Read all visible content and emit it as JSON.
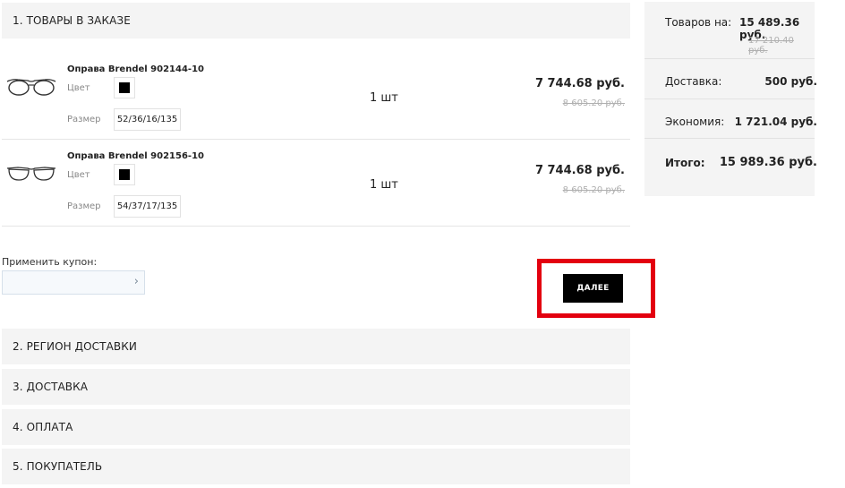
{
  "sections": {
    "cart": "1. ТОВАРЫ В ЗАКАЗЕ",
    "region": "2. РЕГИОН ДОСТАВКИ",
    "delivery": "3. ДОСТАВКА",
    "payment": "4. ОПЛАТА",
    "buyer": "5. ПОКУПАТЕЛЬ"
  },
  "items": [
    {
      "title": "Оправа Brendel 902144-10",
      "color_label": "Цвет",
      "color": "#000000",
      "size_label": "Размер",
      "size": "52/36/16/135",
      "qty": "1 шт",
      "price": "7 744.68 руб.",
      "old_price": "8 605.20 руб."
    },
    {
      "title": "Оправа Brendel 902156-10",
      "color_label": "Цвет",
      "color": "#000000",
      "size_label": "Размер",
      "size": "54/37/17/135",
      "qty": "1 шт",
      "price": "7 744.68 руб.",
      "old_price": "8 605.20 руб."
    }
  ],
  "coupon": {
    "label": "Применить купон:",
    "value": "",
    "arrow": "›"
  },
  "next_button": "ДАЛЕЕ",
  "summary": {
    "goods_label": "Товаров на:",
    "goods_value": "15 489.36 руб.",
    "goods_old": "17 210.40 руб.",
    "shipping_label": "Доставка:",
    "shipping_value": "500 руб.",
    "savings_label": "Экономия:",
    "savings_value": "1 721.04 руб.",
    "total_label": "Итого:",
    "total_value": "15 989.36 руб."
  },
  "colors": {
    "highlight": "#e3000f",
    "button_bg": "#000000",
    "panel_bg": "#f4f4f4"
  }
}
